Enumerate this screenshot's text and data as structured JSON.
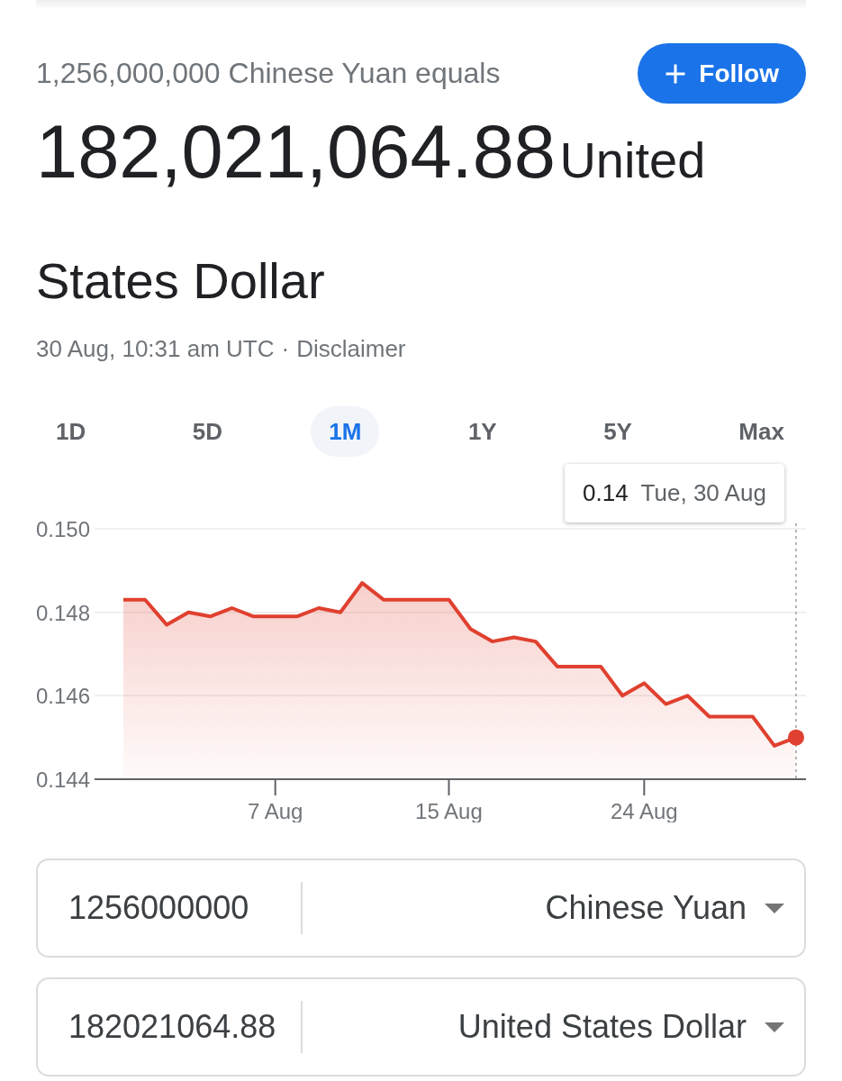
{
  "header": {
    "title": "1,256,000,000 Chinese Yuan equals",
    "follow_button": "Follow"
  },
  "result": {
    "amount": "182,021,064.88",
    "currency": "United States Dollar"
  },
  "meta": {
    "timestamp": "30 Aug, 10:31 am UTC",
    "separator": "·",
    "disclaimer": "Disclaimer"
  },
  "ranges": [
    {
      "label": "1D",
      "selected": false
    },
    {
      "label": "5D",
      "selected": false
    },
    {
      "label": "1M",
      "selected": true
    },
    {
      "label": "1Y",
      "selected": false
    },
    {
      "label": "5Y",
      "selected": false
    },
    {
      "label": "Max",
      "selected": false
    }
  ],
  "chart": {
    "tooltip": {
      "value": "0.14",
      "date": "Tue, 30 Aug"
    },
    "chart_data": {
      "type": "area",
      "categories": [
        null,
        null,
        null,
        null,
        null,
        null,
        null,
        "7 Aug",
        null,
        null,
        null,
        null,
        null,
        null,
        null,
        "15 Aug",
        null,
        null,
        null,
        null,
        null,
        null,
        null,
        null,
        "24 Aug",
        null,
        null,
        null,
        null,
        null,
        null,
        null
      ],
      "series": [
        {
          "color": "#e0402f",
          "values": [
            0.1483,
            0.1483,
            0.1477,
            0.148,
            0.1479,
            0.1481,
            0.1479,
            0.1479,
            0.1479,
            0.1481,
            0.148,
            0.1487,
            0.1483,
            0.1483,
            0.1483,
            0.1483,
            0.1476,
            0.1473,
            0.1474,
            0.1473,
            0.1467,
            0.1467,
            0.1467,
            0.146,
            0.1463,
            0.1458,
            0.146,
            0.1455,
            0.1455,
            0.1455,
            0.1448,
            0.145
          ]
        }
      ],
      "ylim": [
        0.144,
        0.15
      ],
      "yticks": [
        {
          "value": 0.15,
          "label": "0.150"
        },
        {
          "value": 0.148,
          "label": "0.148"
        },
        {
          "value": 0.146,
          "label": "0.146"
        },
        {
          "value": 0.144,
          "label": "0.144"
        }
      ]
    }
  },
  "converter": [
    {
      "value": "1256000000",
      "currency": "Chinese Yuan"
    },
    {
      "value": "182021064.88",
      "currency": "United States Dollar"
    }
  ]
}
